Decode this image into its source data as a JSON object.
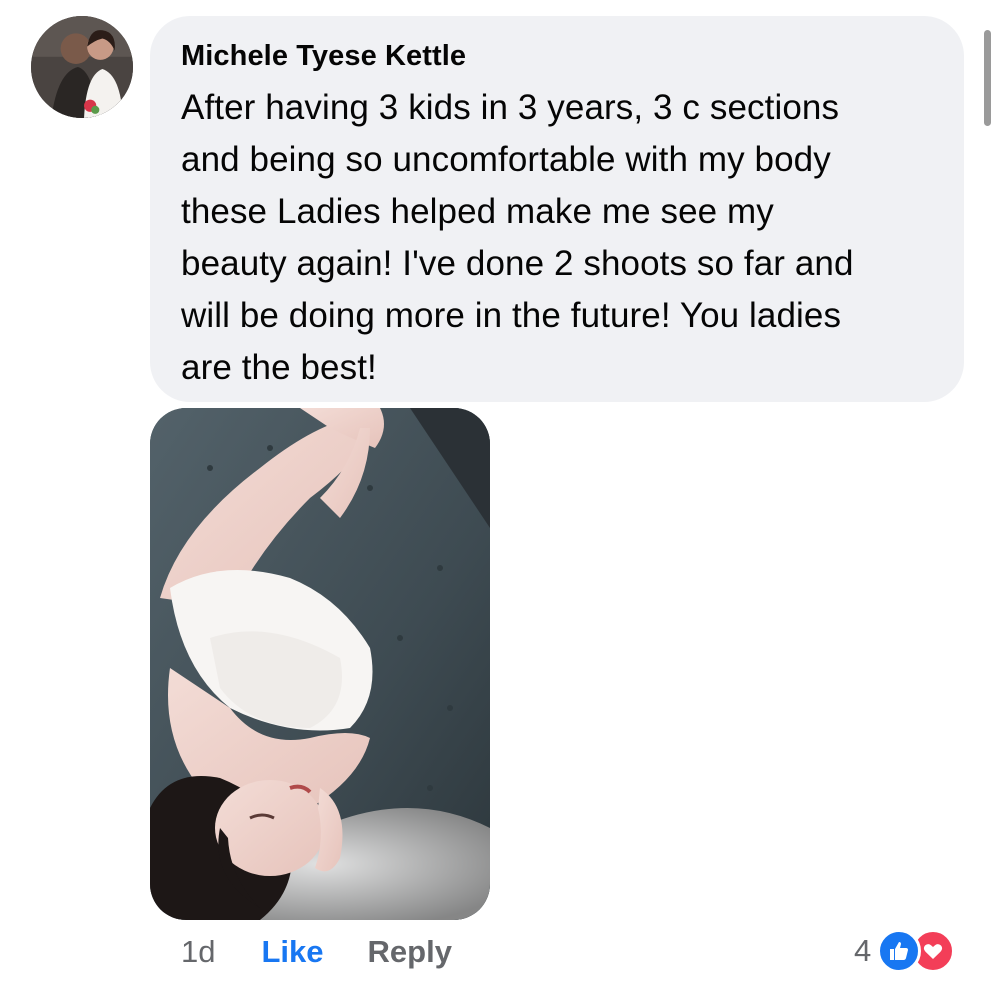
{
  "comment": {
    "author": "Michele Tyese Kettle",
    "lines": [
      "After having 3 kids in 3 years, 3 c sections",
      "and being so uncomfortable with my body",
      "these Ladies helped make me see my",
      "beauty again! I've done 2 shoots so far and",
      "will be doing more in the future! You ladies",
      "are the best!"
    ],
    "avatar_icon": "profile-photo",
    "attachment_icon": "photo-attachment"
  },
  "meta": {
    "time": "1d",
    "like_label": "Like",
    "reply_label": "Reply"
  },
  "reactions": {
    "count": "4",
    "icons": [
      "like-reaction-icon",
      "love-reaction-icon"
    ],
    "colors": {
      "like": "#1877f2",
      "love": "#f33e58"
    }
  },
  "colors": {
    "bubble": "#f0f1f4",
    "accent": "#1877f2",
    "muted": "#65676b"
  }
}
